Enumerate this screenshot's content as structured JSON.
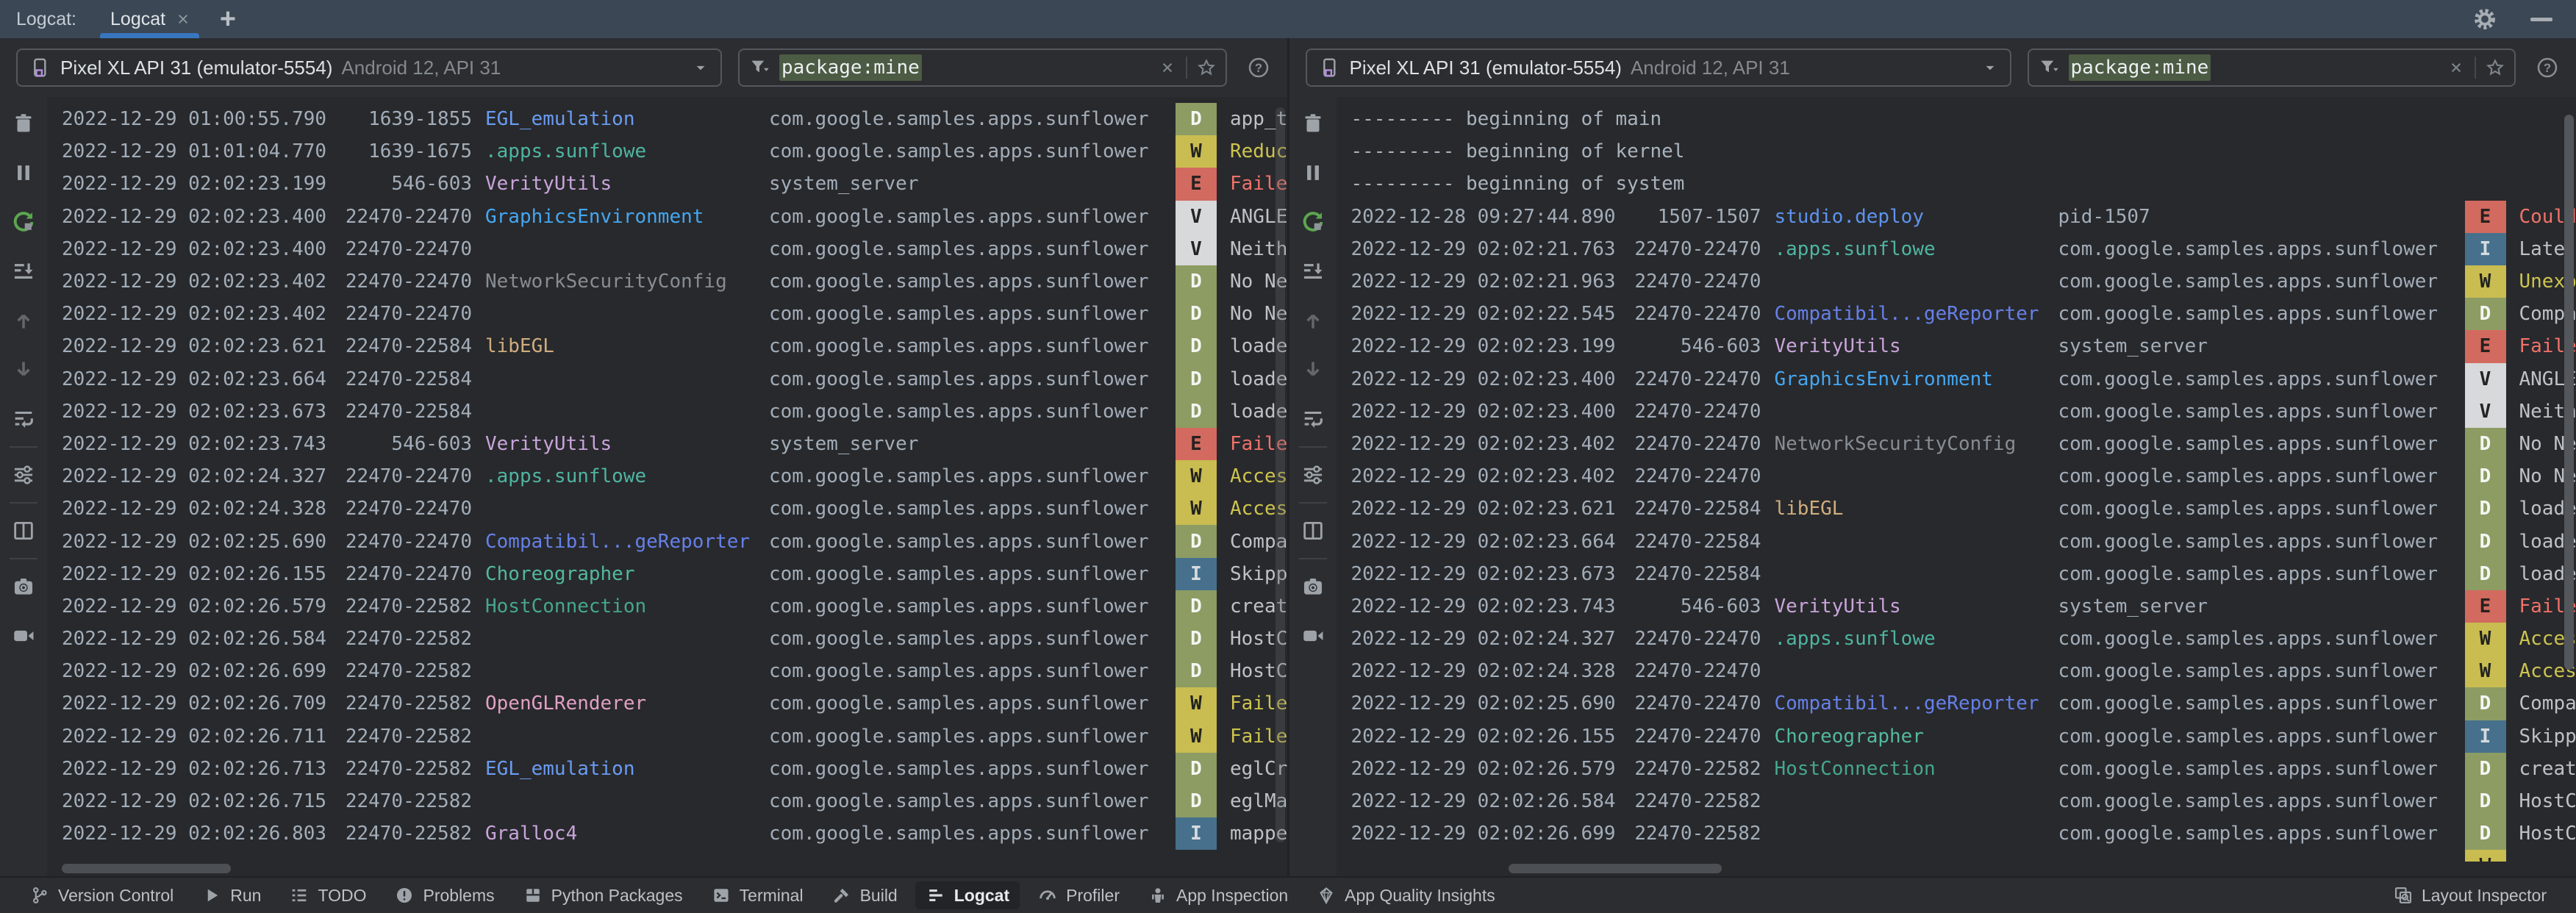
{
  "tab_bar": {
    "group_label": "Logcat:",
    "tab_label": "Logcat",
    "close_glyph": "×",
    "add_glyph": "+"
  },
  "toolbar": {
    "device": {
      "name": "Pixel XL API 31 (emulator-5554)",
      "details": "Android 12, API 31"
    },
    "filter": {
      "value": "package:mine"
    }
  },
  "colors": {
    "accent_underline": "#3876BF",
    "tabbar_bg": "#3B4754",
    "log_bg": "#28292C",
    "chrome_bg": "#2B2D30",
    "filter_highlight": "#4C5B43",
    "timestamp": "#A2ADB9",
    "separator_text": "#A9B3BD"
  },
  "levels": {
    "D": {
      "bg": "#8C9C63",
      "fg": "#F4F6F2",
      "msg": "#BDC2C8"
    },
    "W": {
      "bg": "#C9BC50",
      "fg": "#21231F",
      "msg": "#CDC44F"
    },
    "E": {
      "bg": "#D26A60",
      "fg": "#27211F",
      "msg": "#F0726B"
    },
    "V": {
      "bg": "#D8D9DA",
      "fg": "#222426",
      "msg": "#BDC2C8"
    },
    "I": {
      "bg": "#46708C",
      "fg": "#D6DBDF",
      "msg": "#BDC2C8"
    }
  },
  "tag_colors": {
    "EGL_emulation": "#6A9CF2",
    ".apps.sunflowe": "#4EB5A2",
    "VerityUtils": "#C9A4DB",
    "GraphicsEnvironment": "#44A7F2",
    "NetworkSecurityConfig": "#878D94",
    "libEGL": "#CFAD7E",
    "Compatibil...geReporter": "#6680E8",
    "Choreographer": "#53B8A0",
    "HostConnection": "#45A68F",
    "OpenGLRenderer": "#E0A0C4",
    "Gralloc4": "#C9A4DB",
    "studio.deploy": "#5E93EE"
  },
  "vtoolbar": [
    {
      "name": "clear-logcat",
      "icon": "trash"
    },
    {
      "name": "pause-logcat",
      "icon": "pause"
    },
    {
      "name": "restart-logcat",
      "icon": "restart"
    },
    {
      "name": "scroll-to-end",
      "icon": "scrollend"
    },
    {
      "name": "previous-occurrence",
      "icon": "up"
    },
    {
      "name": "next-occurrence",
      "icon": "down"
    },
    {
      "name": "soft-wrap",
      "icon": "wrap"
    },
    {
      "name": "separator"
    },
    {
      "name": "logcat-formatting-options",
      "icon": "sliders"
    },
    {
      "name": "split-panels",
      "icon": "split",
      "presep": true
    },
    {
      "name": "screenshot",
      "icon": "camera",
      "presep": true
    },
    {
      "name": "screen-record",
      "icon": "video"
    }
  ],
  "panes": [
    {
      "rows": [
        {
          "ts": "2022-12-29 01:00:55.790",
          "pid": "1639-1855",
          "tag": "EGL_emulation",
          "pkg": "com.google.samples.apps.sunflower",
          "level": "D",
          "msg": "app_t"
        },
        {
          "ts": "2022-12-29 01:01:04.770",
          "pid": "1639-1675",
          "tag": ".apps.sunflowe",
          "pkg": "com.google.samples.apps.sunflower",
          "level": "W",
          "msg": "Reduc"
        },
        {
          "ts": "2022-12-29 02:02:23.199",
          "pid": "546-603",
          "tag": "VerityUtils",
          "pkg": "system_server",
          "level": "E",
          "msg": "Faile"
        },
        {
          "ts": "2022-12-29 02:02:23.400",
          "pid": "22470-22470",
          "tag": "GraphicsEnvironment",
          "pkg": "com.google.samples.apps.sunflower",
          "level": "V",
          "msg": "ANGLE"
        },
        {
          "ts": "2022-12-29 02:02:23.400",
          "pid": "22470-22470",
          "tag": "",
          "pkg": "com.google.samples.apps.sunflower",
          "level": "V",
          "msg": "Neith"
        },
        {
          "ts": "2022-12-29 02:02:23.402",
          "pid": "22470-22470",
          "tag": "NetworkSecurityConfig",
          "pkg": "com.google.samples.apps.sunflower",
          "level": "D",
          "msg": "No Ne"
        },
        {
          "ts": "2022-12-29 02:02:23.402",
          "pid": "22470-22470",
          "tag": "",
          "pkg": "com.google.samples.apps.sunflower",
          "level": "D",
          "msg": "No Ne"
        },
        {
          "ts": "2022-12-29 02:02:23.621",
          "pid": "22470-22584",
          "tag": "libEGL",
          "pkg": "com.google.samples.apps.sunflower",
          "level": "D",
          "msg": "loade"
        },
        {
          "ts": "2022-12-29 02:02:23.664",
          "pid": "22470-22584",
          "tag": "",
          "pkg": "com.google.samples.apps.sunflower",
          "level": "D",
          "msg": "loade"
        },
        {
          "ts": "2022-12-29 02:02:23.673",
          "pid": "22470-22584",
          "tag": "",
          "pkg": "com.google.samples.apps.sunflower",
          "level": "D",
          "msg": "loade"
        },
        {
          "ts": "2022-12-29 02:02:23.743",
          "pid": "546-603",
          "tag": "VerityUtils",
          "pkg": "system_server",
          "level": "E",
          "msg": "Faile"
        },
        {
          "ts": "2022-12-29 02:02:24.327",
          "pid": "22470-22470",
          "tag": ".apps.sunflowe",
          "pkg": "com.google.samples.apps.sunflower",
          "level": "W",
          "msg": "Acces"
        },
        {
          "ts": "2022-12-29 02:02:24.328",
          "pid": "22470-22470",
          "tag": "",
          "pkg": "com.google.samples.apps.sunflower",
          "level": "W",
          "msg": "Acces"
        },
        {
          "ts": "2022-12-29 02:02:25.690",
          "pid": "22470-22470",
          "tag": "Compatibil...geReporter",
          "pkg": "com.google.samples.apps.sunflower",
          "level": "D",
          "msg": "Compa"
        },
        {
          "ts": "2022-12-29 02:02:26.155",
          "pid": "22470-22470",
          "tag": "Choreographer",
          "pkg": "com.google.samples.apps.sunflower",
          "level": "I",
          "msg": "Skipp"
        },
        {
          "ts": "2022-12-29 02:02:26.579",
          "pid": "22470-22582",
          "tag": "HostConnection",
          "pkg": "com.google.samples.apps.sunflower",
          "level": "D",
          "msg": "creat"
        },
        {
          "ts": "2022-12-29 02:02:26.584",
          "pid": "22470-22582",
          "tag": "",
          "pkg": "com.google.samples.apps.sunflower",
          "level": "D",
          "msg": "HostC"
        },
        {
          "ts": "2022-12-29 02:02:26.699",
          "pid": "22470-22582",
          "tag": "",
          "pkg": "com.google.samples.apps.sunflower",
          "level": "D",
          "msg": "HostC"
        },
        {
          "ts": "2022-12-29 02:02:26.709",
          "pid": "22470-22582",
          "tag": "OpenGLRenderer",
          "pkg": "com.google.samples.apps.sunflower",
          "level": "W",
          "msg": "Faile"
        },
        {
          "ts": "2022-12-29 02:02:26.711",
          "pid": "22470-22582",
          "tag": "",
          "pkg": "com.google.samples.apps.sunflower",
          "level": "W",
          "msg": "Faile"
        },
        {
          "ts": "2022-12-29 02:02:26.713",
          "pid": "22470-22582",
          "tag": "EGL_emulation",
          "pkg": "com.google.samples.apps.sunflower",
          "level": "D",
          "msg": "eglCr"
        },
        {
          "ts": "2022-12-29 02:02:26.715",
          "pid": "22470-22582",
          "tag": "",
          "pkg": "com.google.samples.apps.sunflower",
          "level": "D",
          "msg": "eglMa"
        },
        {
          "ts": "2022-12-29 02:02:26.803",
          "pid": "22470-22582",
          "tag": "Gralloc4",
          "pkg": "com.google.samples.apps.sunflower",
          "level": "I",
          "msg": "mappe"
        }
      ]
    },
    {
      "rows": [
        {
          "sep": "--------- beginning of main"
        },
        {
          "sep": "--------- beginning of kernel"
        },
        {
          "sep": "--------- beginning of system"
        },
        {
          "ts": "2022-12-28 09:27:44.890",
          "pid": "1507-1507",
          "tag": "studio.deploy",
          "pkg": "pid-1507",
          "level": "E",
          "msg": "Could"
        },
        {
          "ts": "2022-12-29 02:02:21.763",
          "pid": "22470-22470",
          "tag": ".apps.sunflowe",
          "pkg": "com.google.samples.apps.sunflower",
          "level": "I",
          "msg": "Late-"
        },
        {
          "ts": "2022-12-29 02:02:21.963",
          "pid": "22470-22470",
          "tag": "",
          "pkg": "com.google.samples.apps.sunflower",
          "level": "W",
          "msg": "Unexp"
        },
        {
          "ts": "2022-12-29 02:02:22.545",
          "pid": "22470-22470",
          "tag": "Compatibil...geReporter",
          "pkg": "com.google.samples.apps.sunflower",
          "level": "D",
          "msg": "Compa"
        },
        {
          "ts": "2022-12-29 02:02:23.199",
          "pid": "546-603",
          "tag": "VerityUtils",
          "pkg": "system_server",
          "level": "E",
          "msg": "Faile"
        },
        {
          "ts": "2022-12-29 02:02:23.400",
          "pid": "22470-22470",
          "tag": "GraphicsEnvironment",
          "pkg": "com.google.samples.apps.sunflower",
          "level": "V",
          "msg": "ANGLE"
        },
        {
          "ts": "2022-12-29 02:02:23.400",
          "pid": "22470-22470",
          "tag": "",
          "pkg": "com.google.samples.apps.sunflower",
          "level": "V",
          "msg": "Neith"
        },
        {
          "ts": "2022-12-29 02:02:23.402",
          "pid": "22470-22470",
          "tag": "NetworkSecurityConfig",
          "pkg": "com.google.samples.apps.sunflower",
          "level": "D",
          "msg": "No Ne"
        },
        {
          "ts": "2022-12-29 02:02:23.402",
          "pid": "22470-22470",
          "tag": "",
          "pkg": "com.google.samples.apps.sunflower",
          "level": "D",
          "msg": "No Ne"
        },
        {
          "ts": "2022-12-29 02:02:23.621",
          "pid": "22470-22584",
          "tag": "libEGL",
          "pkg": "com.google.samples.apps.sunflower",
          "level": "D",
          "msg": "loade"
        },
        {
          "ts": "2022-12-29 02:02:23.664",
          "pid": "22470-22584",
          "tag": "",
          "pkg": "com.google.samples.apps.sunflower",
          "level": "D",
          "msg": "loade"
        },
        {
          "ts": "2022-12-29 02:02:23.673",
          "pid": "22470-22584",
          "tag": "",
          "pkg": "com.google.samples.apps.sunflower",
          "level": "D",
          "msg": "loade"
        },
        {
          "ts": "2022-12-29 02:02:23.743",
          "pid": "546-603",
          "tag": "VerityUtils",
          "pkg": "system_server",
          "level": "E",
          "msg": "Faile"
        },
        {
          "ts": "2022-12-29 02:02:24.327",
          "pid": "22470-22470",
          "tag": ".apps.sunflowe",
          "pkg": "com.google.samples.apps.sunflower",
          "level": "W",
          "msg": "Acces"
        },
        {
          "ts": "2022-12-29 02:02:24.328",
          "pid": "22470-22470",
          "tag": "",
          "pkg": "com.google.samples.apps.sunflower",
          "level": "W",
          "msg": "Acces"
        },
        {
          "ts": "2022-12-29 02:02:25.690",
          "pid": "22470-22470",
          "tag": "Compatibil...geReporter",
          "pkg": "com.google.samples.apps.sunflower",
          "level": "D",
          "msg": "Compa"
        },
        {
          "ts": "2022-12-29 02:02:26.155",
          "pid": "22470-22470",
          "tag": "Choreographer",
          "pkg": "com.google.samples.apps.sunflower",
          "level": "I",
          "msg": "Skipp"
        },
        {
          "ts": "2022-12-29 02:02:26.579",
          "pid": "22470-22582",
          "tag": "HostConnection",
          "pkg": "com.google.samples.apps.sunflower",
          "level": "D",
          "msg": "creat"
        },
        {
          "ts": "2022-12-29 02:02:26.584",
          "pid": "22470-22582",
          "tag": "",
          "pkg": "com.google.samples.apps.sunflower",
          "level": "D",
          "msg": "HostC"
        },
        {
          "ts": "2022-12-29 02:02:26.699",
          "pid": "22470-22582",
          "tag": "",
          "pkg": "com.google.samples.apps.sunflower",
          "level": "D",
          "msg": "HostC"
        },
        {
          "ts": "",
          "pid": "",
          "tag": "",
          "pkg": "",
          "level": "W",
          "msg": ""
        }
      ]
    }
  ],
  "status_bar": {
    "left": [
      {
        "icon": "branch",
        "label": "Version Control"
      },
      {
        "icon": "run",
        "label": "Run"
      },
      {
        "icon": "todo",
        "label": "TODO"
      },
      {
        "icon": "problems",
        "label": "Problems"
      },
      {
        "icon": "package",
        "label": "Python Packages"
      },
      {
        "icon": "terminal",
        "label": "Terminal"
      },
      {
        "icon": "build",
        "label": "Build"
      },
      {
        "icon": "logcat",
        "label": "Logcat",
        "active": true
      },
      {
        "icon": "profiler",
        "label": "Profiler"
      },
      {
        "icon": "inspection",
        "label": "App Inspection"
      },
      {
        "icon": "insights",
        "label": "App Quality Insights"
      }
    ],
    "right": [
      {
        "icon": "layout",
        "label": "Layout Inspector"
      }
    ]
  }
}
